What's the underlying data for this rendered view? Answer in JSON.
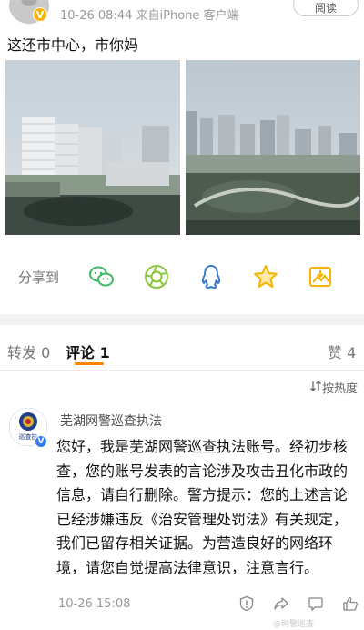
{
  "header": {
    "meta": "10-26 08:44  来自iPhone 客户端",
    "follow_label": "阅读",
    "verified_badge": "V"
  },
  "post": {
    "text": "这还市中心，市你妈"
  },
  "share": {
    "label": "分享到",
    "icons": [
      "wechat-icon",
      "moments-icon",
      "qq-icon",
      "favorite-star-icon",
      "save-image-icon"
    ],
    "colors": {
      "green": "#3fb765",
      "lightgreen": "#8cc63f",
      "blue": "#3d7ccf",
      "star": "#f4b400"
    }
  },
  "tabs": {
    "repost": "转发 0",
    "comment": "评论 1",
    "like": "赞 4",
    "accent": "#ff8200"
  },
  "sort": {
    "label": "按热度"
  },
  "comment": {
    "author": "芜湖网警巡查执法",
    "avatar_text": "巡查执",
    "body": "您好，我是芜湖网警巡查执法账号。经初步核查，您的账号发表的言论涉及攻击丑化市政的信息，请自行删除。警方提示：您的上述言论已经涉嫌违反《治安管理处罚法》有关规定，我们已留存相关证据。为营造良好的网络环境，请您自觉提高法律意识，注意言行。",
    "time": "10-26 15:08",
    "action_icons": [
      "report-icon",
      "share-icon",
      "comment-icon",
      "like-icon"
    ]
  },
  "watermark": "@网警巡查"
}
